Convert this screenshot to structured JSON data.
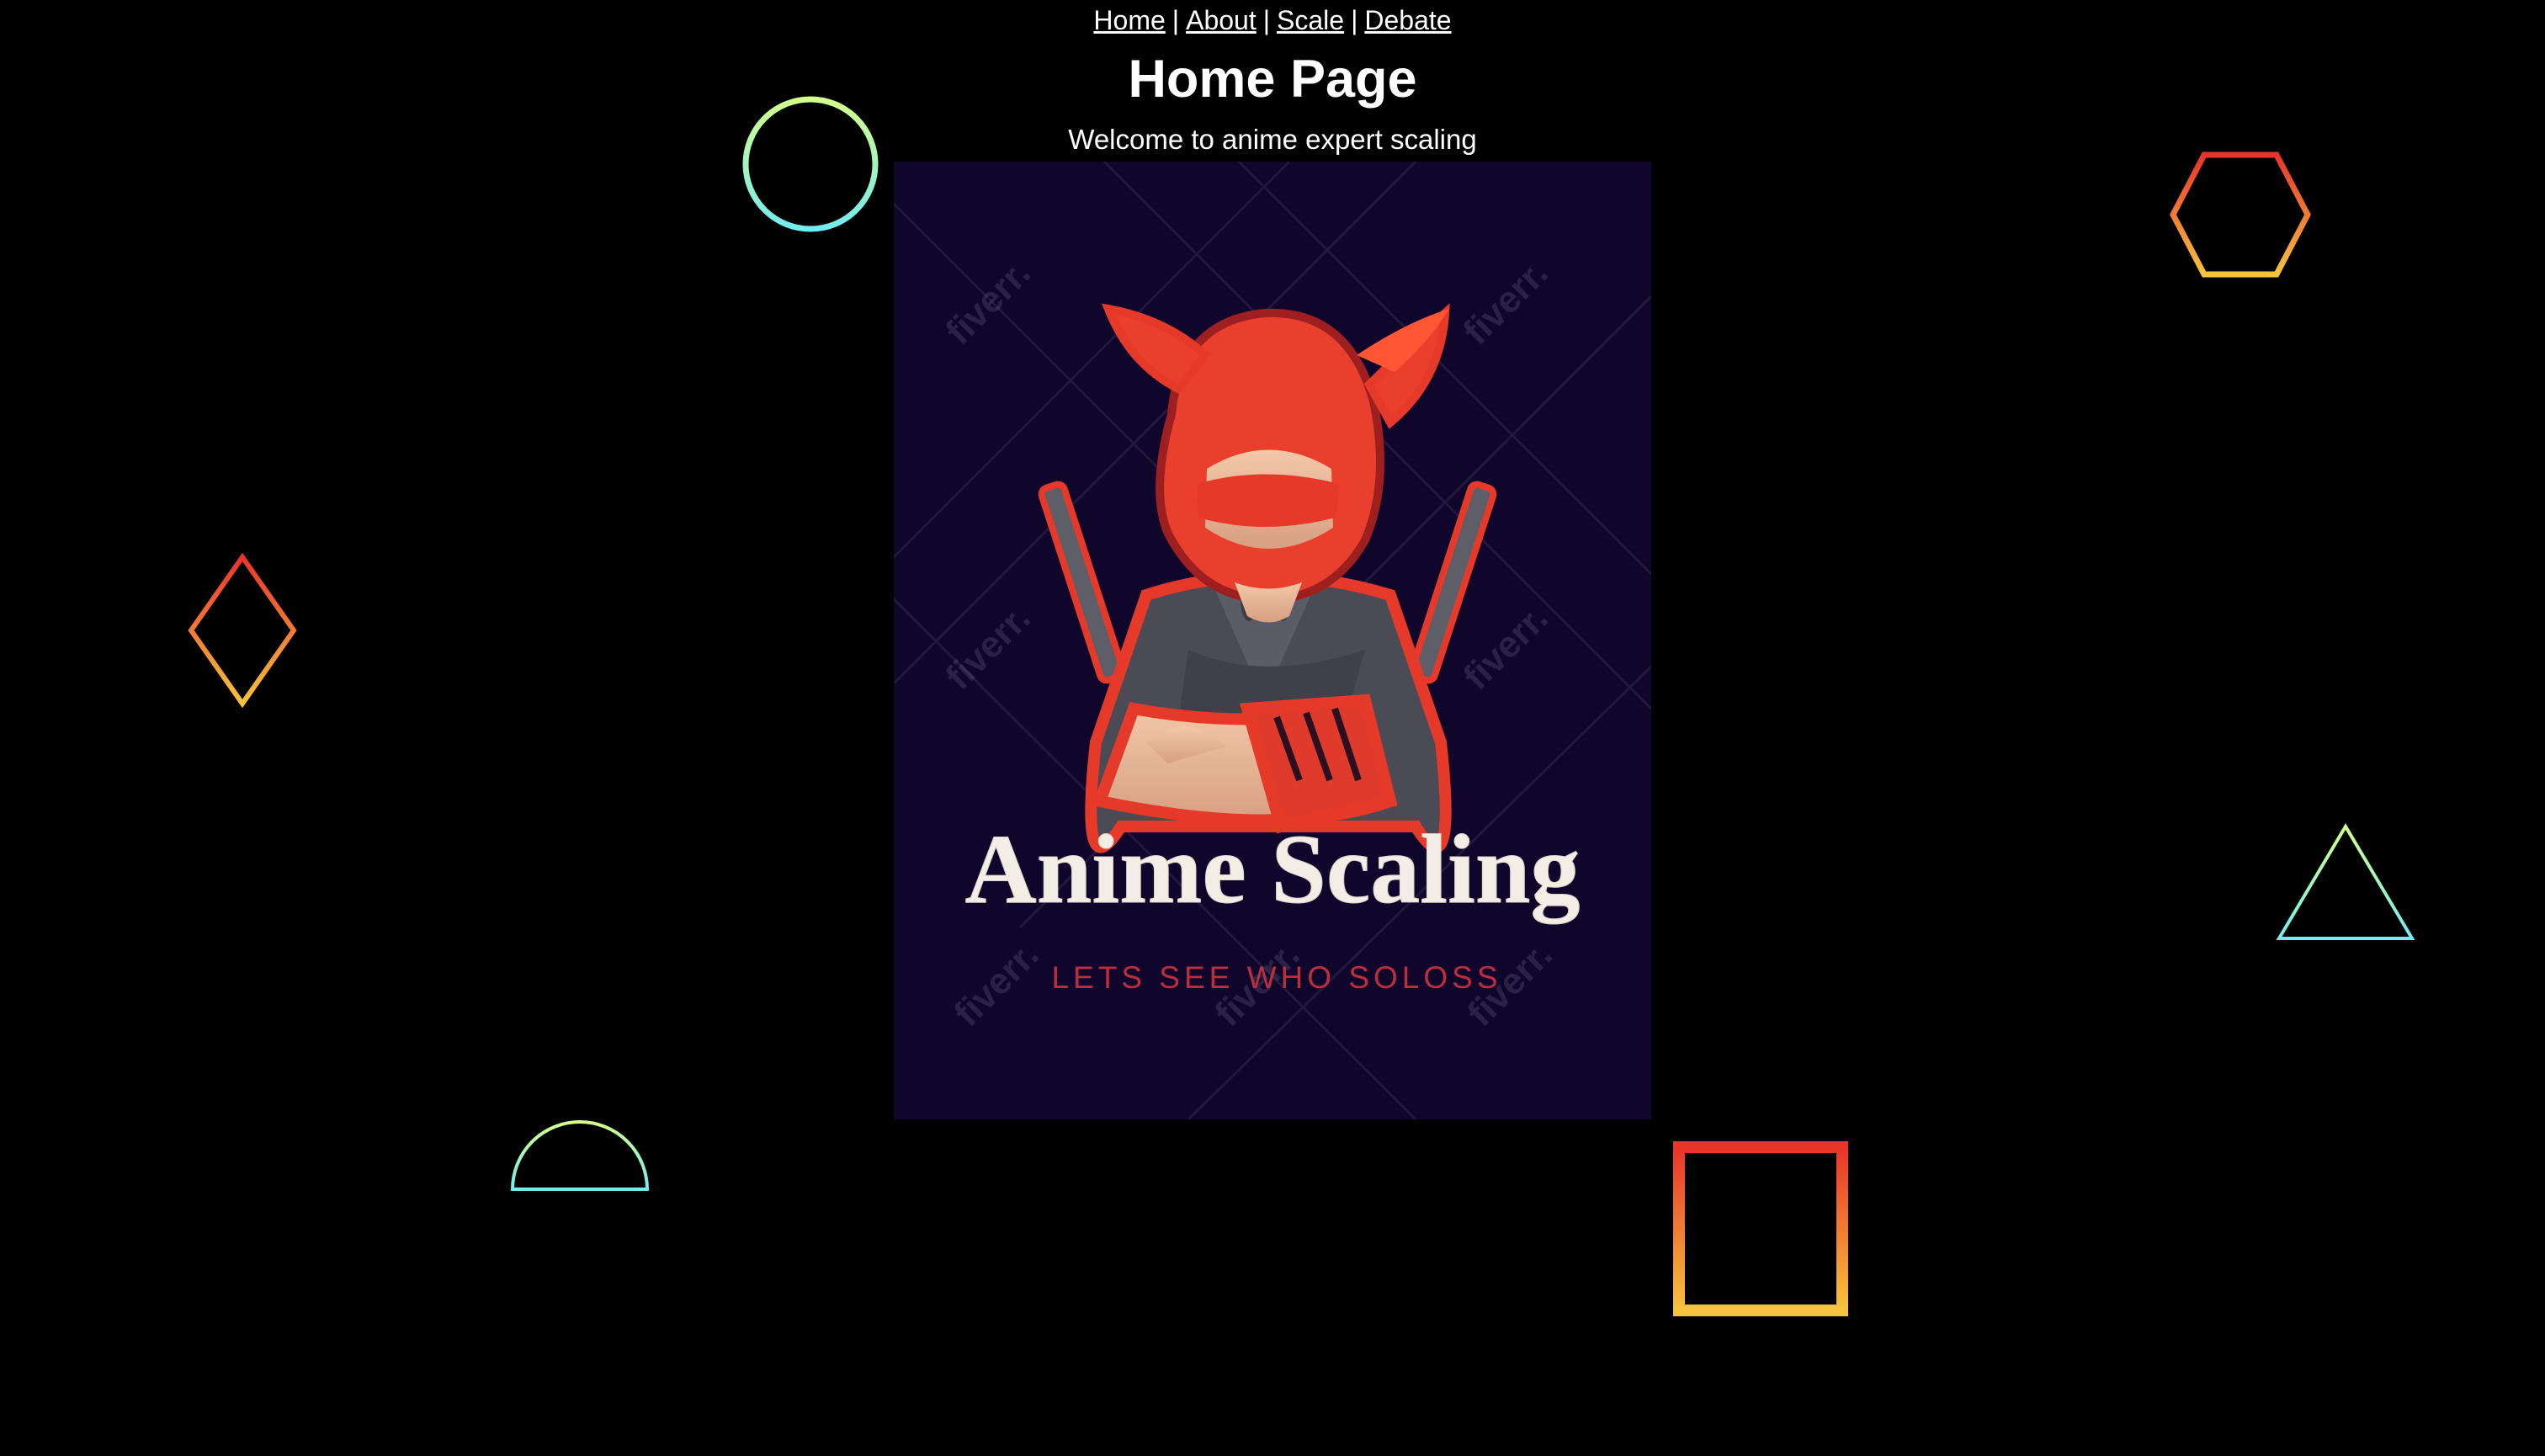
{
  "nav": {
    "links": [
      "Home",
      "About",
      "Scale",
      "Debate"
    ],
    "separator": "|"
  },
  "page": {
    "title": "Home Page",
    "subtitle": "Welcome to anime expert scaling"
  },
  "poster": {
    "logo_title": "Anime Scaling",
    "logo_tagline": "LETS SEE WHO SOLOSS",
    "watermark": "fiverr.",
    "background": "#10052b",
    "accent": "#e53a2a"
  },
  "colors": {
    "background": "#000000",
    "text": "#ffffff",
    "shape_gradient_red": "#e8342a",
    "shape_gradient_yellow": "#f7c33e",
    "shape_gradient_lime": "#d4ff8a",
    "shape_gradient_cyan": "#74ebf0"
  },
  "decorative_shapes": [
    "circle-outline",
    "hexagon-outline",
    "diamond-outline",
    "triangle-outline",
    "semicircle-outline",
    "square-outline"
  ]
}
